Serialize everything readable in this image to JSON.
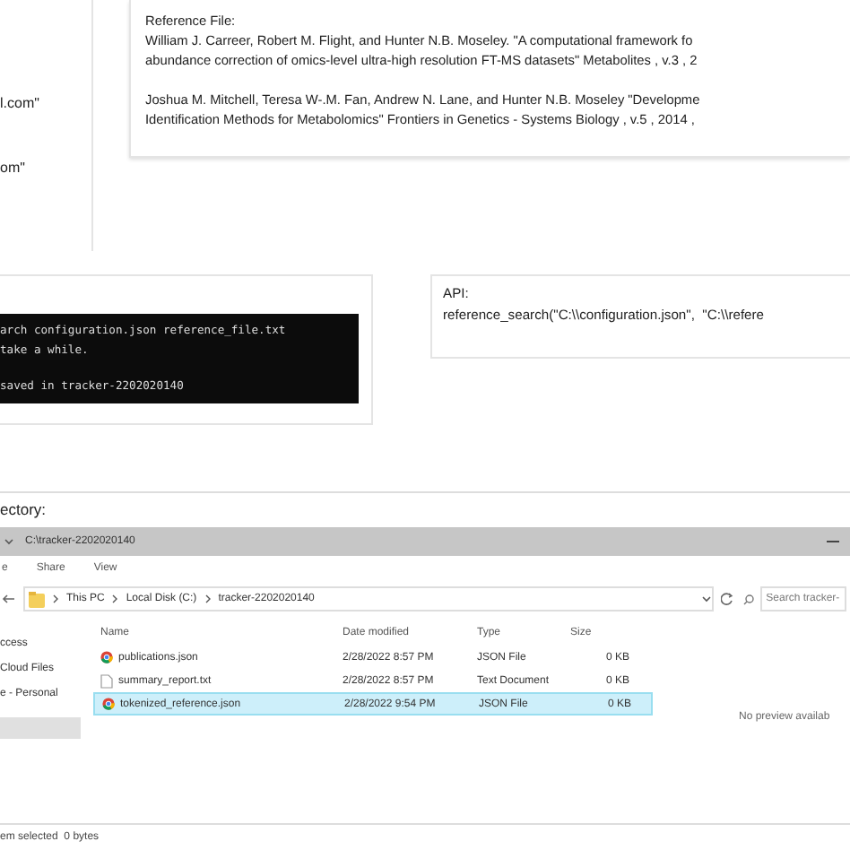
{
  "contact_panel": {
    "lines": [
      "l.com\"",
      "om\""
    ]
  },
  "reference_panel": {
    "label": "Reference File:",
    "entries": [
      {
        "lines": [
          "William J. Carreer, Robert M. Flight, and Hunter N.B. Moseley. \"A computational framework fo",
          "abundance correction of omics-level ultra-high resolution FT-MS datasets\" Metabolites , v.3 , 2"
        ]
      },
      {
        "lines": [
          "Joshua M. Mitchell, Teresa W-.M. Fan, Andrew N. Lane, and Hunter N.B. Moseley \"Developme",
          "Identification Methods for Metabolomics\" Frontiers in Genetics - Systems Biology , v.5 , 2014 ,"
        ]
      }
    ]
  },
  "terminal_panel": {
    "blocks": [
      [
        "arch configuration.json reference_file.txt",
        "take a while."
      ],
      [
        "saved in tracker-2202020140"
      ]
    ]
  },
  "api_panel": {
    "label": "API:",
    "code": "reference_search(\"C:\\\\configuration.json\",  \"C:\\\\refere"
  },
  "directory_label": "ectory:",
  "explorer": {
    "title": "C:\\tracker-2202020140",
    "ribbon_tabs": [
      "e",
      "Share",
      "View"
    ],
    "breadcrumb": [
      "This PC",
      "Local Disk (C:)",
      "tracker-2202020140"
    ],
    "search": {
      "placeholder": "Search tracker-"
    },
    "columns": [
      "Name",
      "Date modified",
      "Type",
      "Size"
    ],
    "nav_items": [
      {
        "label": "ccess"
      },
      {
        "label": "Cloud Files"
      },
      {
        "label": "e - Personal"
      }
    ],
    "files": [
      {
        "name": "publications.json",
        "kind": "json",
        "modified": "2/28/2022 8:57 PM",
        "type": "JSON File",
        "size": "0 KB",
        "selected": false
      },
      {
        "name": "summary_report.txt",
        "kind": "text",
        "modified": "2/28/2022 8:57 PM",
        "type": "Text Document",
        "size": "0 KB",
        "selected": false
      },
      {
        "name": "tokenized_reference.json",
        "kind": "json",
        "modified": "2/28/2022 9:54 PM",
        "type": "JSON File",
        "size": "0 KB",
        "selected": true
      }
    ],
    "preview": "No preview availab",
    "status": "em selected  0 bytes"
  }
}
